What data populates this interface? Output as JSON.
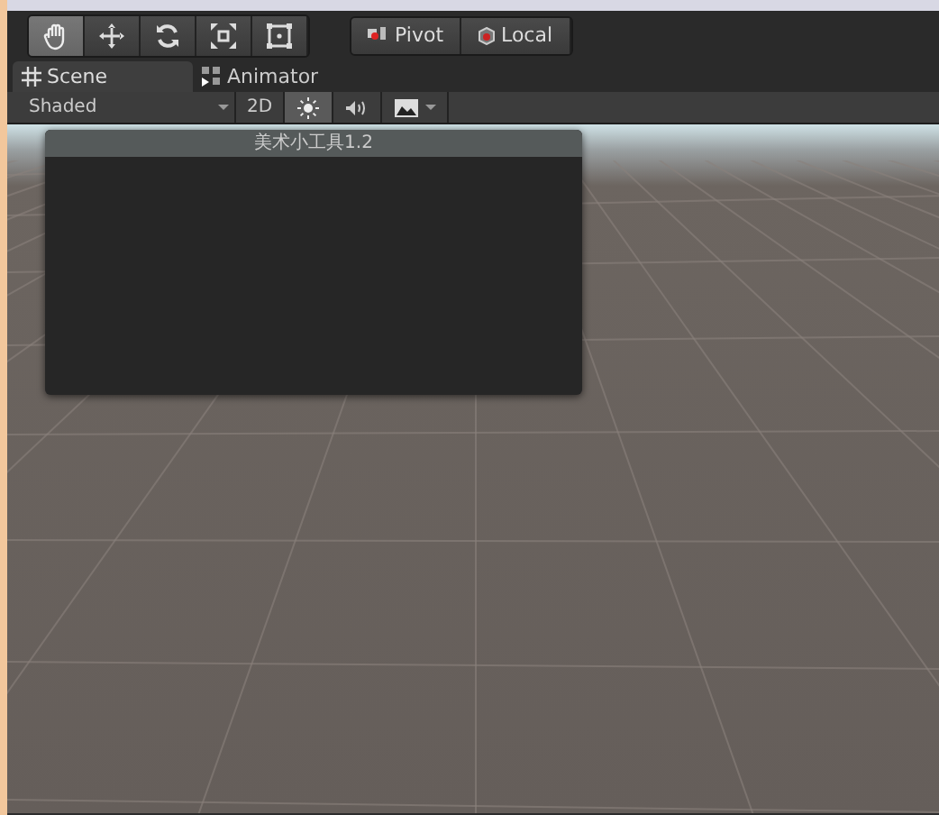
{
  "tools": [
    {
      "kind": "hand",
      "selected": true
    },
    {
      "kind": "move",
      "selected": false
    },
    {
      "kind": "rotate",
      "selected": false
    },
    {
      "kind": "scale",
      "selected": false
    },
    {
      "kind": "rect",
      "selected": false
    }
  ],
  "handle_buttons": [
    {
      "kind": "pivot",
      "label": "Pivot"
    },
    {
      "kind": "local",
      "label": "Local"
    }
  ],
  "tabs": [
    {
      "kind": "scene",
      "label": "Scene",
      "selected": true
    },
    {
      "kind": "animator",
      "label": "Animator",
      "selected": false
    }
  ],
  "scene_toolbar": {
    "draw_mode": "Shaded",
    "buttons": [
      {
        "kind": "projection",
        "label": "2D",
        "selected": false
      },
      {
        "kind": "light",
        "selected": true
      },
      {
        "kind": "audio",
        "selected": false
      },
      {
        "kind": "effects",
        "selected": false
      }
    ]
  },
  "floating_window": {
    "title": "美术小工具1.2"
  }
}
